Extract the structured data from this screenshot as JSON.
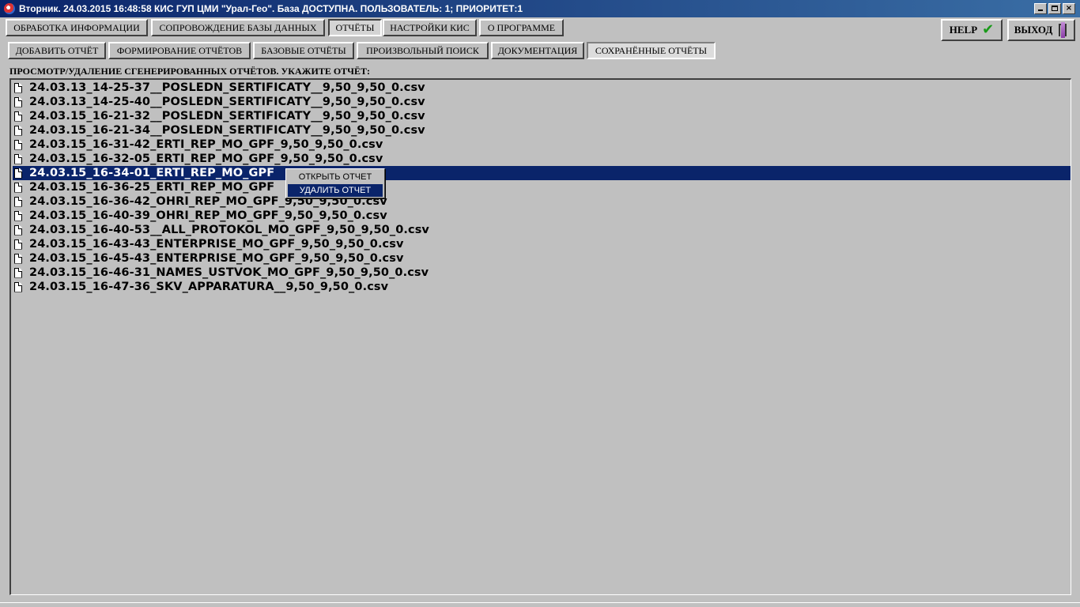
{
  "window": {
    "title": "Вторник. 24.03.2015 16:48:58 КИС ГУП ЦМИ \"Урал-Гео\". База ДОСТУПНА. ПОЛЬЗОВАТЕЛЬ: 1; ПРИОРИТЕТ:1",
    "min_label": "_",
    "max_label": "",
    "close_label": "×"
  },
  "main_tabs": [
    {
      "label": "ОБРАБОТКА ИНФОРМАЦИИ",
      "active": false
    },
    {
      "label": "СОПРОВОЖДЕНИЕ БАЗЫ ДАННЫХ",
      "active": false
    },
    {
      "label": "ОТЧЁТЫ",
      "active": true
    },
    {
      "label": "НАСТРОЙКИ КИС",
      "active": false
    },
    {
      "label": "О ПРОГРАММЕ",
      "active": false
    }
  ],
  "sub_tabs": [
    {
      "label": "ДОБАВИТЬ ОТЧЁТ",
      "active": false
    },
    {
      "label": "ФОРМИРОВАНИЕ ОТЧЁТОВ",
      "active": false
    },
    {
      "label": "БАЗОВЫЕ ОТЧЁТЫ",
      "active": false
    },
    {
      "label": "ПРОИЗВОЛЬНЫЙ ПОИСК",
      "active": false
    },
    {
      "label": "ДОКУМЕНТАЦИЯ",
      "active": false
    },
    {
      "label": "СОХРАНЁННЫЕ ОТЧЁТЫ",
      "active": true
    }
  ],
  "help_button": {
    "label": "HELP",
    "icon": "check-icon"
  },
  "exit_button": {
    "label": "ВЫХОД",
    "icon": "exit-door-icon"
  },
  "section_label": "ПРОСМОТР/УДАЛЕНИЕ СГЕНЕРИРОВАННЫХ ОТЧЁТОВ. УКАЖИТЕ ОТЧЁТ:",
  "files": [
    "24.03.13_14-25-37__POSLEDN_SERTIFICATY__9,50_9,50_0.csv",
    "24.03.13_14-25-40__POSLEDN_SERTIFICATY__9,50_9,50_0.csv",
    "24.03.15_16-21-32__POSLEDN_SERTIFICATY__9,50_9,50_0.csv",
    "24.03.15_16-21-34__POSLEDN_SERTIFICATY__9,50_9,50_0.csv",
    "24.03.15_16-31-42_ERTI_REP_MO_GPF_9,50_9,50_0.csv",
    "24.03.15_16-32-05_ERTI_REP_MO_GPF_9,50_9,50_0.csv",
    "24.03.15_16-34-01_ERTI_REP_MO_GPF",
    "24.03.15_16-36-25_ERTI_REP_MO_GPF",
    "24.03.15_16-36-42_OHRI_REP_MO_GPF_9,50_9,50_0.csv",
    "24.03.15_16-40-39_OHRI_REP_MO_GPF_9,50_9,50_0.csv",
    "24.03.15_16-40-53__ALL_PROTOKOL_MO_GPF_9,50_9,50_0.csv",
    "24.03.15_16-43-43_ENTERPRISE_MO_GPF_9,50_9,50_0.csv",
    "24.03.15_16-45-43_ENTERPRISE_MO_GPF_9,50_9,50_0.csv",
    "24.03.15_16-46-31_NAMES_USTVOK_MO_GPF_9,50_9,50_0.csv",
    "24.03.15_16-47-36_SKV_APPARATURA__9,50_9,50_0.csv"
  ],
  "selected_index": 6,
  "context_menu": {
    "items": [
      {
        "label": "ОТКРЫТЬ ОТЧЕТ",
        "highlighted": false
      },
      {
        "label": "УДАЛИТЬ ОТЧЕТ",
        "highlighted": true
      }
    ]
  },
  "colors": {
    "selection": "#0a246a",
    "background": "#c0c0c0"
  }
}
